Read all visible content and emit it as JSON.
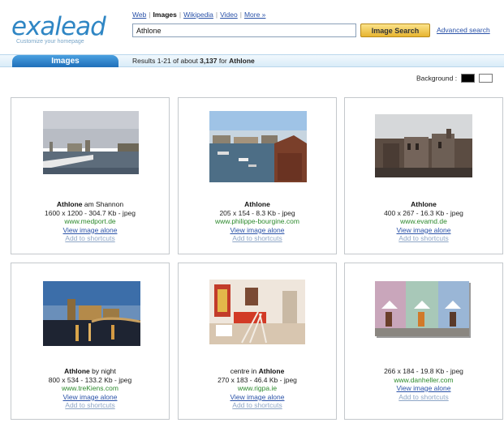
{
  "logo": {
    "text": "exalead",
    "tagline": "Customize your homepage"
  },
  "nav": {
    "tabs": [
      {
        "label": "Web"
      },
      {
        "label": "Images",
        "active": true
      },
      {
        "label": "Wikipedia"
      },
      {
        "label": "Video"
      },
      {
        "label": "More »"
      }
    ]
  },
  "search": {
    "query": "Athlone",
    "button_label": "Image Search",
    "advanced_label": "Advanced search"
  },
  "section": {
    "tab_label": "Images",
    "results_prefix": "Results 1-21 of about ",
    "results_count": "3,137",
    "results_for": " for ",
    "results_query": "Athlone"
  },
  "background": {
    "label": "Background :",
    "options": [
      "black",
      "white"
    ]
  },
  "results": [
    {
      "title_bold": "Athlone",
      "title_rest": " am Shannon",
      "meta": "1600 x 1200 - 304.7 Kb - jpeg",
      "url": "www.medport.de",
      "view": "View image alone",
      "add": "Add to shortcuts"
    },
    {
      "title_bold": "Athlone",
      "title_rest": "",
      "meta": "205 x 154 - 8.3 Kb - jpeg",
      "url": "www.philippe-bourgine.com",
      "view": "View image alone",
      "add": "Add to shortcuts"
    },
    {
      "title_bold": "Athlone",
      "title_rest": "",
      "meta": "400 x 267 - 16.3 Kb - jpeg",
      "url": "www.evamd.de",
      "view": "View image alone",
      "add": "Add to shortcuts"
    },
    {
      "title_bold": "Athlone",
      "title_rest": " by night",
      "meta": "800 x 534 - 133.2 Kb - jpeg",
      "url": "www.treKiens.com",
      "view": "View image alone",
      "add": "Add to shortcuts"
    },
    {
      "title_pre": "centre in ",
      "title_bold": "Athlone",
      "title_rest": "",
      "meta": "270 x 183 - 46.4 Kb - jpeg",
      "url": "www.rigpa.ie",
      "view": "View image alone",
      "add": "Add to shortcuts"
    },
    {
      "title_bold": "",
      "title_rest": "",
      "meta": "266 x 184 - 19.8 Kb - jpeg",
      "url": "www.danheller.com",
      "view": "View image alone",
      "add": "Add to shortcuts"
    }
  ],
  "colors": {
    "brand": "#2f86c4",
    "link": "#2a52a8",
    "url": "#2d8a2d",
    "button": "#e7b430"
  }
}
